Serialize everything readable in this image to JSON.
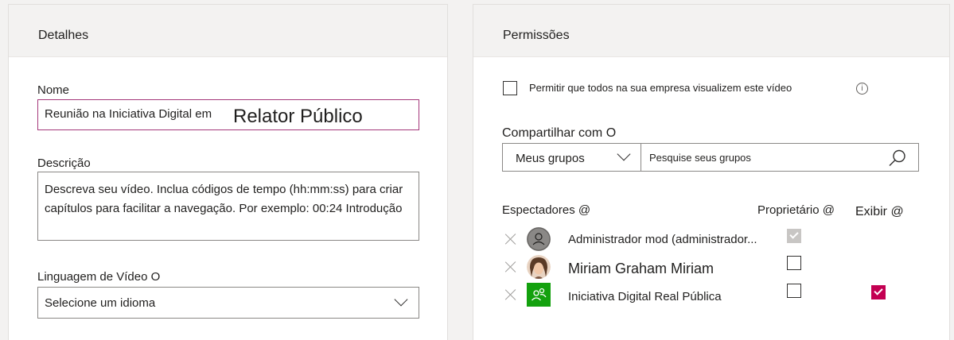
{
  "details": {
    "title": "Detalhes",
    "name_label": "Nome",
    "name_value": "Reunião na Iniciativa Digital em",
    "name_caption": "Relator Público",
    "description_label": "Descrição",
    "description_value": "Descreva seu vídeo. Inclua códigos de tempo (hh:mm:ss) para criar capítulos para facilitar a navegação. Por exemplo: 00:24 Introdução",
    "language_label": "Linguagem de Vídeo O",
    "language_value": "Selecione um idioma"
  },
  "permissions": {
    "title": "Permissões",
    "allow_company_label": "Permitir que todos na sua empresa visualizem este vídeo",
    "info_glyph": "i",
    "share_label": "Compartilhar com O",
    "groups_select_value": "Meus grupos",
    "search_placeholder": "Pesquise seus grupos",
    "col_viewers": "Espectadores @",
    "col_owner": "Proprietário @",
    "col_display": "Exibir @",
    "rows": [
      {
        "name": "Administrador mod (administrador...",
        "owner": true,
        "display": false
      },
      {
        "name": "Miriam Graham Miriam",
        "owner": false,
        "display": false
      },
      {
        "name": "Iniciativa Digital Real Pública",
        "owner": false,
        "display": true
      }
    ]
  },
  "colors": {
    "accent": "#c30052",
    "focus_border": "#a4377a",
    "group_avatar": "#13a10e"
  }
}
